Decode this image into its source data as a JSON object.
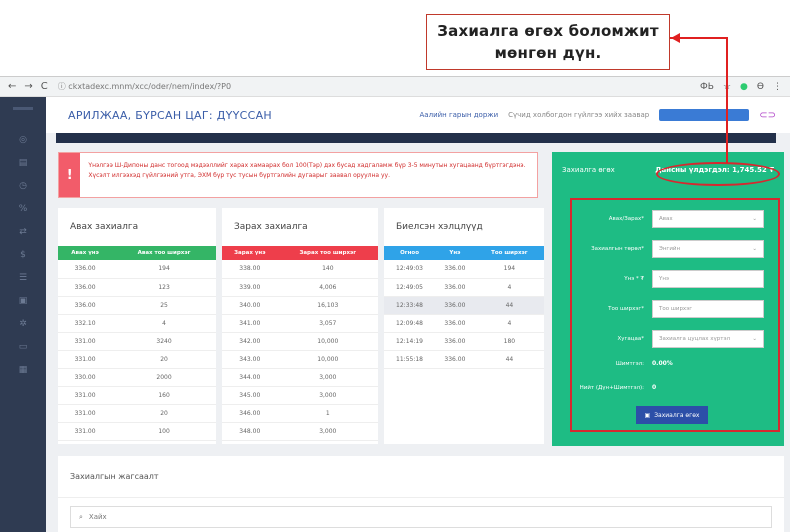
{
  "callout": {
    "line1": "Захиалга өгөх боломжит",
    "line2": "мөнгөн дүн."
  },
  "browser": {
    "nav": [
      "←",
      "→",
      "C"
    ],
    "url": "ⓘ  ckxtadexc.mnm/xcc/oder/nem/index/?P0",
    "ext": [
      "ФЬ",
      "☆",
      "●",
      "Ө",
      "⋮"
    ]
  },
  "header": {
    "title": "АРИЛЖАА, БҮРСАН ЦАГ: ДҮҮССАН",
    "doc_link": "Аалийн гарын доржи",
    "note": "Сүчид холбогдон гүйлгээ хийх заавар"
  },
  "alert": {
    "icon": "!",
    "text": "Үнэлгээ Ш-Дипоны данс тогоод мэдээллийг харах хамаарах бол 100(Тэр) дэх бусад хадгаламж бүр 3-5 минутын хугацаанд бүртгэгдэнэ. Хүсэлт илгээхэд гүйлгээний утга, ЭХМ бүр тус тусын бүртгэлийн дугаарыг заавал оруулна уу."
  },
  "buy": {
    "title": "Авах захиалга",
    "headers": [
      "Авах үнэ",
      "Авах тоо ширхэг"
    ],
    "rows": [
      [
        "336.00",
        "194"
      ],
      [
        "336.00",
        "123"
      ],
      [
        "336.00",
        "25"
      ],
      [
        "332.10",
        "4"
      ],
      [
        "331.00",
        "3240"
      ],
      [
        "331.00",
        "20"
      ],
      [
        "330.00",
        "2000"
      ],
      [
        "331.00",
        "160"
      ],
      [
        "331.00",
        "20"
      ],
      [
        "331.00",
        "100"
      ]
    ]
  },
  "sell": {
    "title": "Зарах захиалга",
    "headers": [
      "Зарах үнэ",
      "Зарах тоо ширхэг"
    ],
    "rows": [
      [
        "338.00",
        "140"
      ],
      [
        "339.00",
        "4,006"
      ],
      [
        "340.00",
        "16,103"
      ],
      [
        "341.00",
        "3,057"
      ],
      [
        "342.00",
        "10,000"
      ],
      [
        "343.00",
        "10,000"
      ],
      [
        "344.00",
        "3,000"
      ],
      [
        "345.00",
        "3,000"
      ],
      [
        "346.00",
        "1"
      ],
      [
        "348.00",
        "3,000"
      ]
    ]
  },
  "recent": {
    "title": "Биелсэн хэлцлүүд",
    "headers": [
      "Огноо",
      "Үнэ",
      "Тоо ширхэг"
    ],
    "rows": [
      [
        "12:49:03",
        "336.00",
        "194"
      ],
      [
        "12:49:05",
        "336.00",
        "4"
      ],
      [
        "12:33:48",
        "336.00",
        "44"
      ],
      [
        "12:09:48",
        "336.00",
        "4"
      ],
      [
        "12:14:19",
        "336.00",
        "180"
      ],
      [
        "11:55:18",
        "336.00",
        "44"
      ]
    ]
  },
  "order": {
    "title": "Захиалга өгөх",
    "balance": "Дансны үлдэгдэл: 1,745.52 ₮",
    "fields": [
      {
        "label": "Авах/Зарах*",
        "value": "Авах",
        "dropdown": true
      },
      {
        "label": "Захиалгын төрөл*",
        "value": "Энгийн",
        "dropdown": true
      },
      {
        "label": "Үнэ * ₮",
        "value": "Үнэ",
        "dropdown": false
      },
      {
        "label": "Тоо ширхэг*",
        "value": "Тоо ширхэг",
        "dropdown": false
      },
      {
        "label": "Хугацаа*",
        "value": "Захиалга цуцлах хүртэл",
        "dropdown": true
      }
    ],
    "fee_label": "Шимтгэл:",
    "fee_value": "0.00%",
    "total_label": "Нийт (Дүн+Шимтгэл):",
    "total_value": "0",
    "submit": "Захиалга өгөх"
  },
  "placed": {
    "title": "Захиалгын жагсаалт",
    "search_icon": "⌕",
    "search_value": "Хайх"
  }
}
